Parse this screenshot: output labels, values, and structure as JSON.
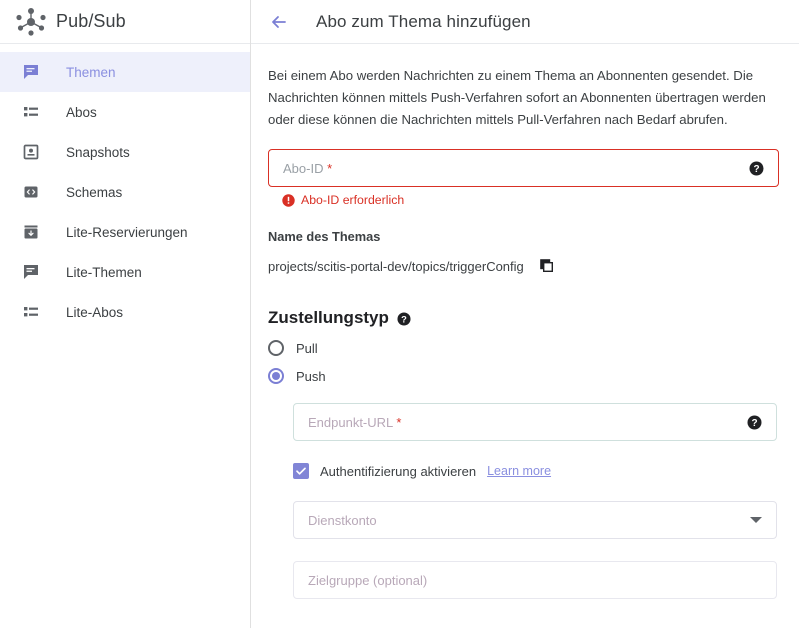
{
  "sidebar": {
    "product_title": "Pub/Sub",
    "logo_icon": "pubsub-hub-spoke-icon",
    "items": [
      {
        "label": "Themen",
        "icon": "message-icon",
        "active": true
      },
      {
        "label": "Abos",
        "icon": "list-icon",
        "active": false
      },
      {
        "label": "Snapshots",
        "icon": "snapshot-icon",
        "active": false
      },
      {
        "label": "Schemas",
        "icon": "code-brackets-icon",
        "active": false
      },
      {
        "label": "Lite-Reservierungen",
        "icon": "archive-icon",
        "active": false
      },
      {
        "label": "Lite-Themen",
        "icon": "message-icon",
        "active": false
      },
      {
        "label": "Lite-Abos",
        "icon": "list-icon",
        "active": false
      }
    ]
  },
  "header": {
    "back_icon": "arrow-left-icon",
    "title": "Abo zum Thema hinzufügen"
  },
  "main": {
    "intro": "Bei einem Abo werden Nachrichten zu einem Thema an Abonnenten gesendet. Die Nachrichten können mittels Push-Verfahren sofort an Abonnenten übertragen werden oder diese können die Nachrichten mittels Pull-Verfahren nach Bedarf abrufen.",
    "abo_id": {
      "placeholder": "Abo-ID",
      "required_marker": "*",
      "value": "",
      "error_text": "Abo-ID erforderlich",
      "help_icon": "help-circle-icon",
      "error_icon": "error-circle-icon"
    },
    "topic": {
      "label": "Name des Themas",
      "name": "projects/scitis-portal-dev/topics/triggerConfig",
      "copy_icon": "copy-icon"
    },
    "delivery": {
      "heading": "Zustellungstyp",
      "help_icon": "help-circle-icon",
      "options": [
        {
          "label": "Pull",
          "selected": false
        },
        {
          "label": "Push",
          "selected": true
        }
      ]
    },
    "endpoint": {
      "placeholder": "Endpunkt-URL",
      "required_marker": "*",
      "value": "",
      "help_icon": "help-circle-icon"
    },
    "auth": {
      "checkbox_label": "Authentifizierung aktivieren",
      "checked": true,
      "learn_more": "Learn more",
      "check_icon": "checkmark-icon"
    },
    "service_account": {
      "placeholder": "Dienstkonto",
      "value": "",
      "caret_icon": "chevron-down-icon"
    },
    "audience": {
      "placeholder": "Zielgruppe (optional)",
      "value": ""
    }
  },
  "colors": {
    "accent_purple": "#7b7fd4",
    "active_nav_bg": "#eef0fb",
    "active_nav_text": "#8a8fe0",
    "error_red": "#d93025",
    "text_primary": "#3c4043",
    "text_muted": "#9aa0a6",
    "border": "#dadce0"
  }
}
